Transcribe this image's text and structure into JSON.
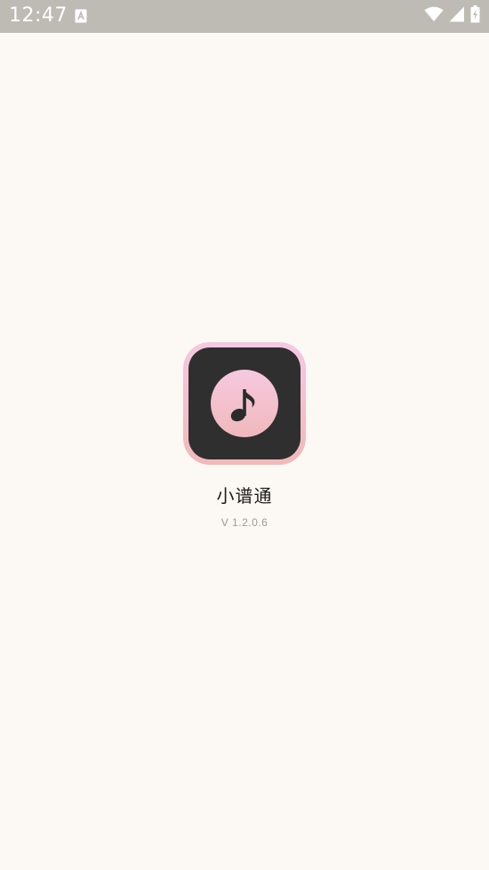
{
  "status_bar": {
    "time": "12:47",
    "icons": [
      "notification-a-icon",
      "wifi-icon",
      "signal-icon",
      "battery-icon"
    ]
  },
  "splash": {
    "app_name": "小谱通",
    "version": "V 1.2.0.6"
  },
  "colors": {
    "background": "#FCF8F3",
    "status_bar": "#BEBBB5",
    "icon_dark": "#2F2F2F",
    "icon_pink": "#F5C8E4",
    "icon_rose": "#F0B9B9"
  }
}
